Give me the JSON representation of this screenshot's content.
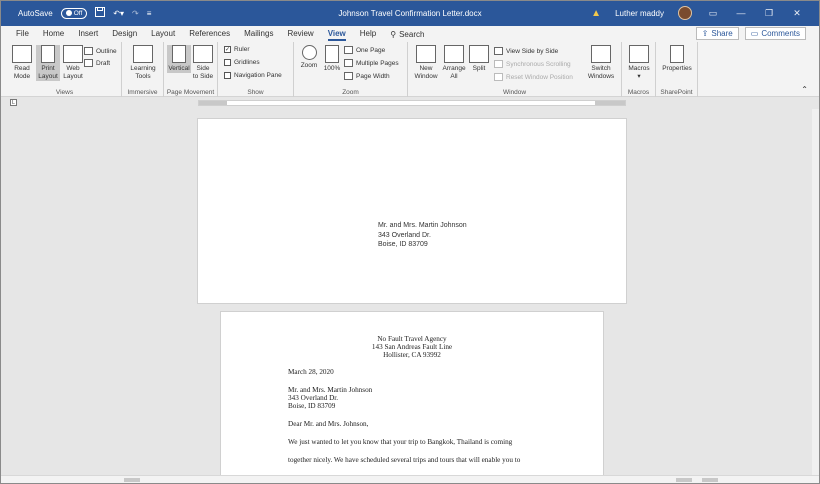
{
  "titlebar": {
    "autosave_label": "AutoSave",
    "autosave_state": "Off",
    "doc_title": "Johnson Travel Confirmation Letter.docx",
    "user_name": "Luther maddy"
  },
  "tabs": [
    "File",
    "Home",
    "Insert",
    "Design",
    "Layout",
    "References",
    "Mailings",
    "Review",
    "View",
    "Help"
  ],
  "active_tab": "View",
  "search_label": "Search",
  "share_label": "Share",
  "comments_label": "Comments",
  "ribbon": {
    "views": {
      "label": "Views",
      "read_mode": [
        "Read",
        "Mode"
      ],
      "print_layout": [
        "Print",
        "Layout"
      ],
      "web_layout": [
        "Web",
        "Layout"
      ],
      "outline": "Outline",
      "draft": "Draft"
    },
    "immersive": {
      "label": "Immersive",
      "learning_tools": [
        "Learning",
        "Tools"
      ]
    },
    "page_movement": {
      "label": "Page Movement",
      "vertical": "Vertical",
      "side_to_side": [
        "Side",
        "to Side"
      ]
    },
    "show": {
      "label": "Show",
      "ruler": "Ruler",
      "gridlines": "Gridlines",
      "navigation_pane": "Navigation Pane"
    },
    "zoom": {
      "label": "Zoom",
      "zoom": "Zoom",
      "hundred": "100%",
      "one_page": "One Page",
      "multiple_pages": "Multiple Pages",
      "page_width": "Page Width"
    },
    "window": {
      "label": "Window",
      "new_window": [
        "New",
        "Window"
      ],
      "arrange_all": [
        "Arrange",
        "All"
      ],
      "split": "Split",
      "view_side_by_side": "View Side by Side",
      "sync_scrolling": "Synchronous Scrolling",
      "reset_position": "Reset Window Position",
      "switch_windows": [
        "Switch",
        "Windows"
      ]
    },
    "macros": {
      "label": "Macros",
      "macros": "Macros"
    },
    "sharepoint": {
      "label": "SharePoint",
      "properties": "Properties"
    }
  },
  "envelope": {
    "recipient": [
      "Mr. and Mrs. Martin Johnson",
      "343 Overland Dr.",
      "Boise, ID  83709"
    ]
  },
  "letter": {
    "sender": [
      "No Fault Travel Agency",
      "143 San Andreas Fault Line",
      "Hollister, CA  93992"
    ],
    "date": "March 28, 2020",
    "recipient": [
      "Mr. and Mrs. Martin Johnson",
      "343 Overland Dr.",
      "Boise, ID  83709"
    ],
    "salutation": "Dear Mr. and Mrs. Johnson,",
    "body": [
      "We just wanted to let you know that your trip to Bangkok, Thailand is coming",
      "together nicely.  We have scheduled several trips and tours that will enable you to"
    ]
  }
}
